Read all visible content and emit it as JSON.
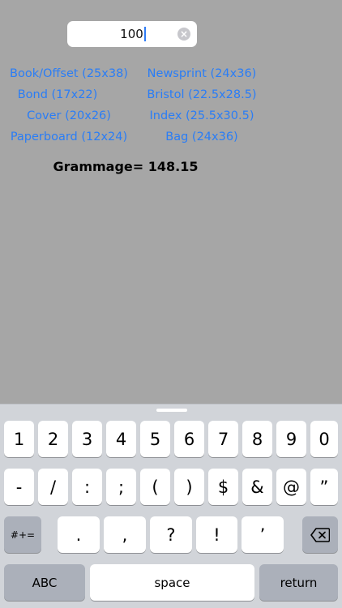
{
  "input": {
    "value": "100"
  },
  "links": {
    "book_offset": "Book/Offset (25x38)",
    "newsprint": "Newsprint (24x36)",
    "bond": "Bond (17x22)",
    "bristol": "Bristol (22.5x28.5)",
    "cover": "Cover (20x26)",
    "index": "Index (25.5x30.5)",
    "paperboard": "Paperboard (12x24)",
    "bag": "Bag (24x36)"
  },
  "result": {
    "text": "Grammage= 148.15"
  },
  "keyboard": {
    "row1": [
      "1",
      "2",
      "3",
      "4",
      "5",
      "6",
      "7",
      "8",
      "9",
      "0"
    ],
    "row2": [
      "-",
      "/",
      ":",
      ";",
      "(",
      ")",
      "$",
      "&",
      "@",
      "”"
    ],
    "row3": {
      "shift": "#+=",
      "keys": [
        ".",
        ",",
        "?",
        "!",
        "’"
      ]
    },
    "bottom": {
      "abc": "ABC",
      "space": "space",
      "return": "return"
    },
    "icons": {
      "clear": "clear-icon",
      "backspace": "backspace-icon"
    }
  },
  "colors": {
    "background": "#a6a6a6",
    "link": "#2a7df6",
    "keyboard": "#d1d4d9",
    "key": "#ffffff",
    "key_dark": "#abb0ba"
  }
}
